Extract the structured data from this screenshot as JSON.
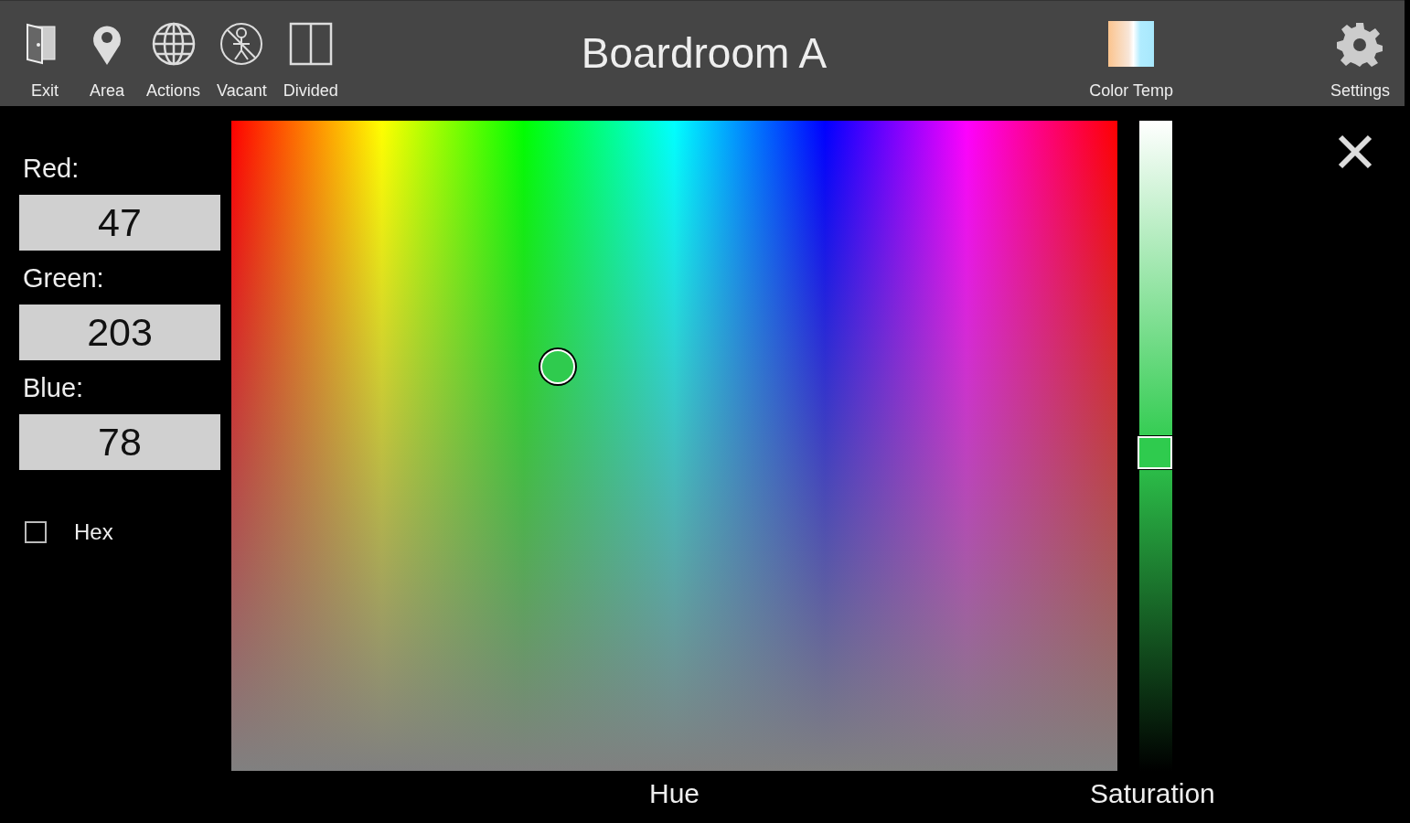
{
  "toolbar": {
    "left_items": [
      {
        "kind": "exit",
        "label": "Exit"
      },
      {
        "kind": "area",
        "label": "Area"
      },
      {
        "kind": "actions",
        "label": "Actions"
      },
      {
        "kind": "vacant",
        "label": "Vacant"
      },
      {
        "kind": "divided",
        "label": "Divided"
      }
    ],
    "title": "Boardroom A",
    "right_items": [
      {
        "kind": "colortemp",
        "label": "Color Temp"
      },
      {
        "kind": "settings",
        "label": "Settings"
      }
    ]
  },
  "fields": [
    {
      "label": "Red:",
      "value": "47"
    },
    {
      "label": "Green:",
      "value": "203"
    },
    {
      "label": "Blue:",
      "value": "78"
    }
  ],
  "hex": {
    "label": "Hex",
    "checked": false
  },
  "picker": {
    "hue_marker": {
      "level": 0.368
    },
    "vertical_marker": {
      "level": 0.378
    },
    "label": "Hue"
  },
  "saturation": {
    "level": 0.49,
    "label": "Saturation"
  }
}
